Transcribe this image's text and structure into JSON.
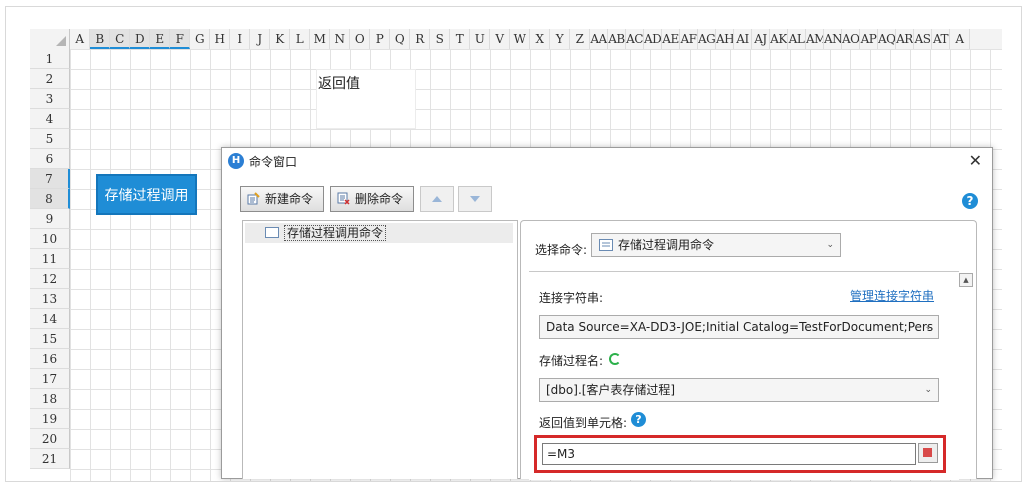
{
  "spreadsheet": {
    "columns": [
      "A",
      "B",
      "C",
      "D",
      "E",
      "F",
      "G",
      "H",
      "I",
      "J",
      "K",
      "L",
      "M",
      "N",
      "O",
      "P",
      "Q",
      "R",
      "S",
      "T",
      "U",
      "V",
      "W",
      "X",
      "Y",
      "Z",
      "AA",
      "AB",
      "AC",
      "AD",
      "AE",
      "AF",
      "AG",
      "AH",
      "AI",
      "AJ",
      "AK",
      "AL",
      "AM",
      "AN",
      "AO",
      "AP",
      "AQ",
      "AR",
      "AS",
      "AT",
      "A"
    ],
    "rows": [
      "1",
      "2",
      "3",
      "4",
      "5",
      "6",
      "7",
      "8",
      "9",
      "10",
      "11",
      "12",
      "13",
      "14",
      "15",
      "16",
      "17",
      "18",
      "19",
      "20",
      "21"
    ],
    "return_value_label": "返回值",
    "proc_cell_text": "存储过程调用"
  },
  "dialog": {
    "title": "命令窗口",
    "new_command": "新建命令",
    "delete_command": "删除命令",
    "tree_item": "存储过程调用命令",
    "select_command_label": "选择命令:",
    "select_command_value": "存储过程调用命令",
    "connection_label": "连接字符串:",
    "manage_connection_link": "管理连接字符串",
    "connection_value": "Data Source=XA-DD3-JOE;Initial Catalog=TestForDocument;Pers",
    "proc_name_label": "存储过程名:",
    "proc_name_value": "[dbo].[客户表存储过程]",
    "return_to_cell_label": "返回值到单元格:",
    "return_to_cell_value": "=M3",
    "help_glyph": "?",
    "app_icon_glyph": "H",
    "close_glyph": "✕"
  },
  "colors": {
    "accent": "#1f8dd6",
    "highlight_border": "#d52929",
    "refresh_icon": "#2bb04a"
  }
}
